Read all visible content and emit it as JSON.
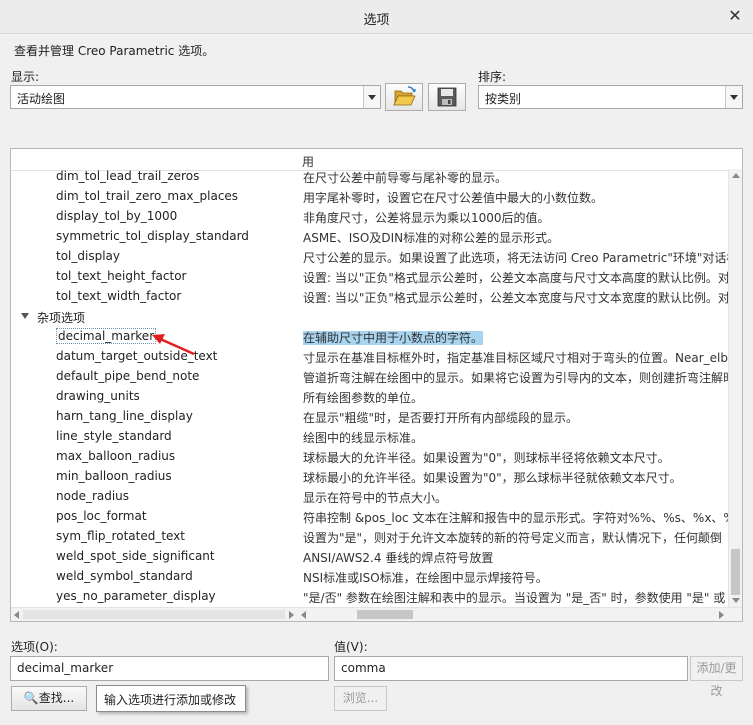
{
  "window": {
    "title": "选项"
  },
  "description": "查看并管理 Creo Parametric 选项。",
  "display": {
    "label": "显示:",
    "value": "活动绘图"
  },
  "sort": {
    "label": "排序:",
    "value": "按类别"
  },
  "tree": {
    "header_col2": "用",
    "rows": [
      {
        "name": "dim_tol_lead_trail_zeros",
        "value": "在尺寸公差中前导零与尾补零的显示。"
      },
      {
        "name": "dim_tol_trail_zero_max_places",
        "value": "用字尾补零时，设置它在尺寸公差值中最大的小数位数。"
      },
      {
        "name": "display_tol_by_1000",
        "value": "非角度尺寸，公差将显示为乘以1000后的值。"
      },
      {
        "name": "symmetric_tol_display_standard",
        "value": "ASME、ISO及DIN标准的对称公差的显示形式。"
      },
      {
        "name": "tol_display",
        "value": "尺寸公差的显示。如果设置了此选项，将无法访问 Creo Parametric\"环境\"对话框"
      },
      {
        "name": "tol_text_height_factor",
        "value": "设置: 当以\"正负\"格式显示公差时，公差文本高度与尺寸文本高度的默认比例。对"
      },
      {
        "name": "tol_text_width_factor",
        "value": "设置: 当以\"正负\"格式显示公差时，公差文本宽度与尺寸文本宽度的默认比例。对"
      },
      {
        "name": "杂项选项",
        "value": "",
        "group": true
      },
      {
        "name": "decimal_marker",
        "value": "在辅助尺寸中用于小数点的字符。",
        "selected": true
      },
      {
        "name": "datum_target_outside_text",
        "value": "寸显示在基准目标框外时，指定基准目标区域尺寸相对于弯头的位置。Near_elb"
      },
      {
        "name": "default_pipe_bend_note",
        "value": "管道折弯注解在绘图中的显示。如果将它设置为引导内的文本，则创建折弯注解时"
      },
      {
        "name": "drawing_units",
        "value": "所有绘图参数的单位。"
      },
      {
        "name": "harn_tang_line_display",
        "value": "在显示\"粗缆\"时，是否要打开所有内部缆段的显示。"
      },
      {
        "name": "line_style_standard",
        "value": "绘图中的线显示标准。"
      },
      {
        "name": "max_balloon_radius",
        "value": "球标最大的允许半径。如果设置为\"0\"，则球标半径将依赖文本尺寸。"
      },
      {
        "name": "min_balloon_radius",
        "value": "球标最小的允许半径。如果设置为\"0\"，那么球标半径就依赖文本尺寸。"
      },
      {
        "name": "node_radius",
        "value": "显示在符号中的节点大小。"
      },
      {
        "name": "pos_loc_format",
        "value": "符串控制 &pos_loc 文本在注解和报告中的显示形式。字符对%%、%s、%x、%"
      },
      {
        "name": "sym_flip_rotated_text",
        "value": "设置为\"是\"，则对于允许文本旋转的新的符号定义而言，默认情况下，任何颠倒"
      },
      {
        "name": "weld_spot_side_significant",
        "value": "ANSI/AWS2.4 垂线的焊点符号放置"
      },
      {
        "name": "weld_symbol_standard",
        "value": "NSI标准或ISO标准，在绘图中显示焊接符号。"
      },
      {
        "name": "yes_no_parameter_display",
        "value": "\"是/否\" 参数在绘图注解和表中的显示。当设置为 \"是_否\" 时，参数使用 \"是\" 或"
      }
    ]
  },
  "option_field": {
    "label": "选项(O):",
    "value": "decimal_marker"
  },
  "value_field": {
    "label": "值(V):",
    "value": "comma"
  },
  "buttons": {
    "add_change": "添加/更改",
    "find": "查找...",
    "browse": "浏览..."
  },
  "tooltip": "输入选项进行添加或修改",
  "colors": {
    "accent": "#e02020",
    "selection": "#a8d4f0"
  }
}
